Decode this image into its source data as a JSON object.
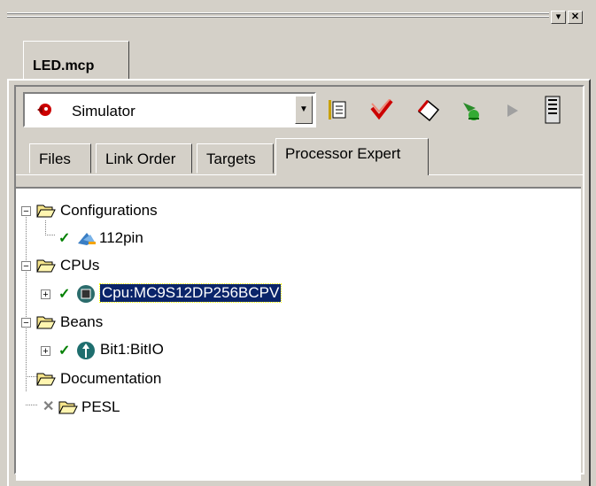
{
  "window": {
    "min_btn": "▾",
    "close_btn": "✕"
  },
  "doc_tab": {
    "label": "LED.mcp"
  },
  "toolbar": {
    "target_select": {
      "value": "Simulator"
    },
    "icons": [
      "settings-icon",
      "check-icon",
      "erase-icon",
      "debug-icon",
      "run-icon",
      "device-icon"
    ]
  },
  "tabs": [
    {
      "label": "Files"
    },
    {
      "label": "Link Order"
    },
    {
      "label": "Targets"
    },
    {
      "label": "Processor Expert",
      "active": true
    }
  ],
  "tree": {
    "configurations": {
      "label": "Configurations",
      "child": "112pin"
    },
    "cpus": {
      "label": "CPUs",
      "child": "Cpu:MC9S12DP256BCPV"
    },
    "beans": {
      "label": "Beans",
      "child": "Bit1:BitIO"
    },
    "documentation": {
      "label": "Documentation"
    },
    "pesl": {
      "label": "PESL"
    }
  },
  "colors": {
    "background": "#d4d0c8",
    "selection": "#0a246a",
    "check": "#008000"
  }
}
